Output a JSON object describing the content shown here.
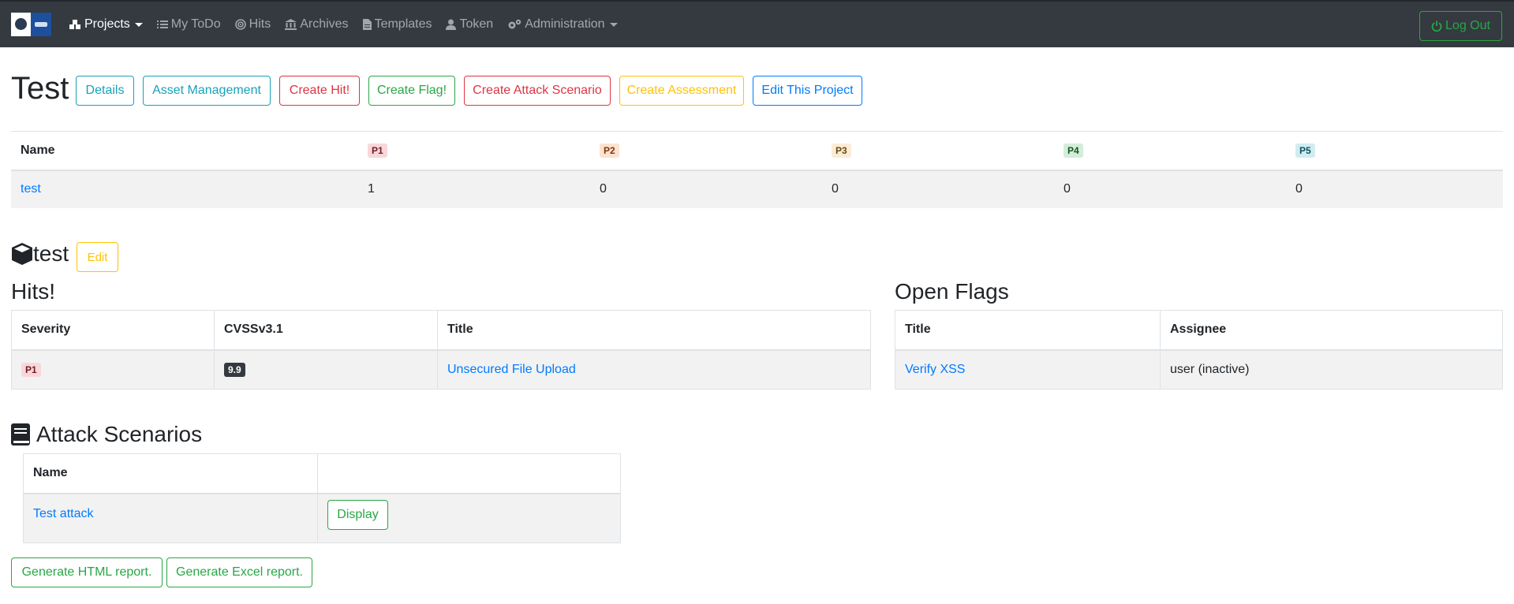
{
  "navbar": {
    "items": [
      {
        "label": "Projects",
        "icon": "cubes-icon",
        "active": true,
        "dropdown": true
      },
      {
        "label": "My ToDo",
        "icon": "list-icon"
      },
      {
        "label": "Hits",
        "icon": "target-icon"
      },
      {
        "label": "Archives",
        "icon": "bank-icon"
      },
      {
        "label": "Templates",
        "icon": "file-icon"
      },
      {
        "label": "Token",
        "icon": "user-icon"
      },
      {
        "label": "Administration",
        "icon": "cogs-icon",
        "dropdown": true
      }
    ],
    "logout_label": "Log Out"
  },
  "header": {
    "title": "Test",
    "buttons": {
      "details": "Details",
      "asset_management": "Asset Management",
      "create_hit": "Create Hit!",
      "create_flag": "Create Flag!",
      "create_attack_scenario": "Create Attack Scenario",
      "create_assessment": "Create Assessment",
      "edit_project": "Edit This Project"
    }
  },
  "summary": {
    "headers": [
      "Name",
      "P1",
      "P2",
      "P3",
      "P4",
      "P5"
    ],
    "row": {
      "name": "test",
      "p1": "1",
      "p2": "0",
      "p3": "0",
      "p4": "0",
      "p5": "0"
    }
  },
  "assessment": {
    "title": "test",
    "edit_label": "Edit"
  },
  "hits": {
    "title": "Hits!",
    "headers": [
      "Severity",
      "CVSSv3.1",
      "Title"
    ],
    "rows": [
      {
        "severity": "P1",
        "cvss": "9.9",
        "title": "Unsecured File Upload"
      }
    ]
  },
  "flags": {
    "title": "Open Flags",
    "headers": [
      "Title",
      "Assignee"
    ],
    "rows": [
      {
        "title": "Verify XSS",
        "assignee": "user (inactive)"
      }
    ]
  },
  "attack_scenarios": {
    "title": "Attack Scenarios",
    "headers": [
      "Name",
      ""
    ],
    "rows": [
      {
        "name": "Test attack",
        "action": "Display"
      }
    ]
  },
  "reports": {
    "html": "Generate HTML report.",
    "excel": "Generate Excel report."
  },
  "colors": {
    "navbar_bg": "#343a40",
    "primary": "#007bff",
    "success": "#28a745",
    "danger": "#dc3545",
    "warning": "#ffc107",
    "info": "#17a2b8"
  }
}
